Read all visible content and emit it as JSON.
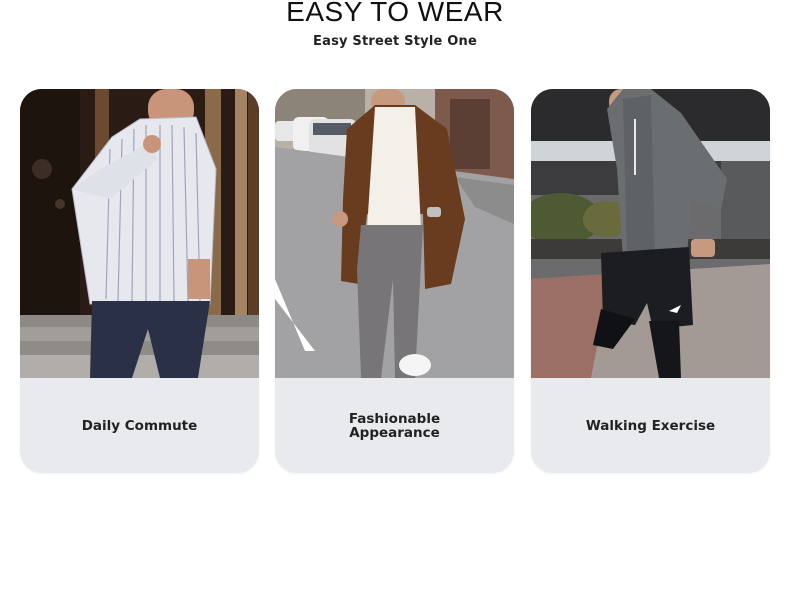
{
  "header": {
    "title": "EASY TO WEAR",
    "subtitle": "Easy Street Style One"
  },
  "cards": [
    {
      "caption": "Daily Commute",
      "image": "man-striped-shirt-photo"
    },
    {
      "caption": "Fashionable Appearance",
      "image": "man-brown-coat-photo"
    },
    {
      "caption": "Walking Exercise",
      "image": "man-hoodie-shorts-photo"
    }
  ]
}
